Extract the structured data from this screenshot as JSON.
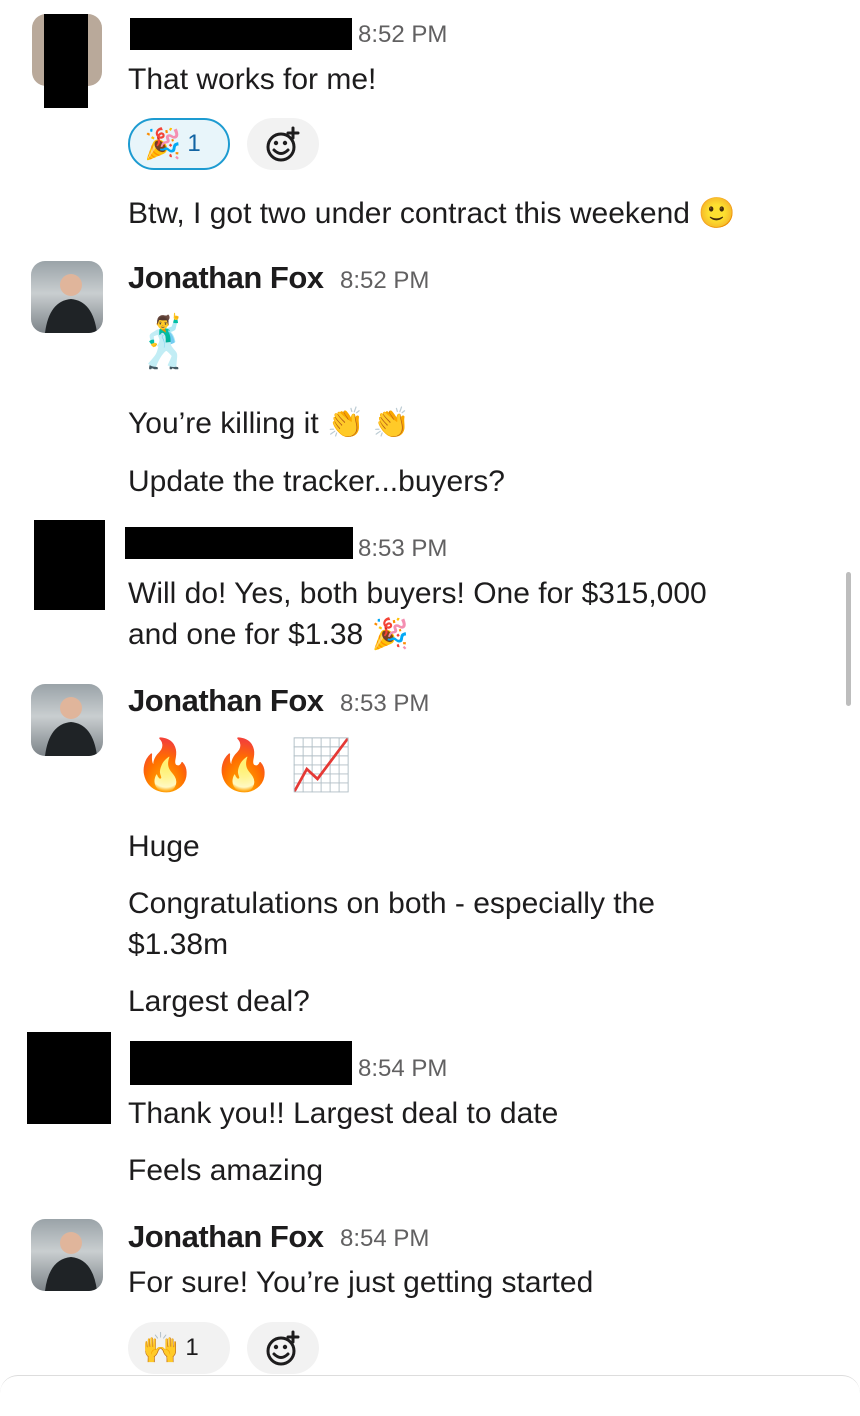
{
  "messages": {
    "m1": {
      "time": "8:52 PM",
      "text1": "That works for me!",
      "reaction_emoji": "🎉",
      "reaction_count": "1",
      "text2": "Btw, I got two under contract this weekend 🙂"
    },
    "m2": {
      "name": "Jonathan Fox",
      "time": "8:52 PM",
      "emoji": "🕺",
      "text1": "You’re killing it 👏 👏",
      "text2": "Update the tracker...buyers?"
    },
    "m3": {
      "time": "8:53 PM",
      "text1": "Will do! Yes, both buyers! One for $315,000",
      "text2": "and one for $1.38 🎉"
    },
    "m4": {
      "name": "Jonathan Fox",
      "time": "8:53 PM",
      "emoji": "🔥 🔥 📈",
      "text1": "Huge",
      "text2": "Congratulations on both - especially the",
      "text3": "$1.38m",
      "text4": "Largest deal?"
    },
    "m5": {
      "time": "8:54 PM",
      "text1": "Thank you!! Largest deal to date",
      "text2": "Feels amazing"
    },
    "m6": {
      "name": "Jonathan Fox",
      "time": "8:54 PM",
      "text1": "For sure! You’re just getting started",
      "reaction_emoji": "🙌",
      "reaction_count": "1"
    }
  },
  "icons": {
    "add_reaction": "add-reaction-icon"
  },
  "colors": {
    "link_blue": "#1264a3",
    "reaction_active_border": "#1d9bd1",
    "reaction_bg": "#f2f2f2"
  }
}
